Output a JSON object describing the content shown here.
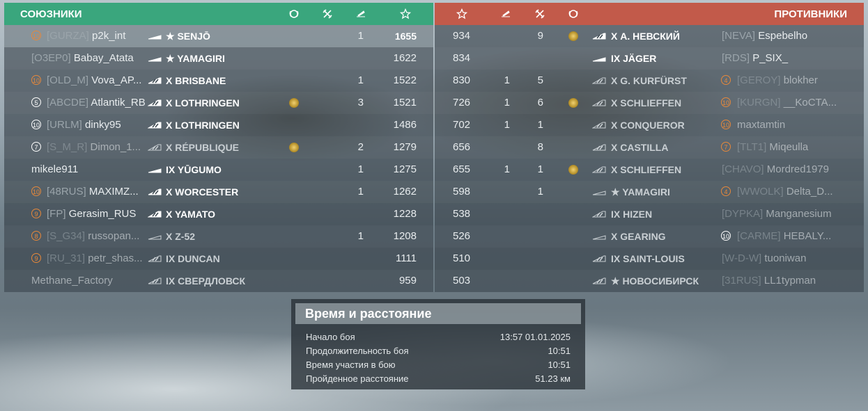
{
  "allies": {
    "title": "СОЮЗНИКИ",
    "header_icons": [
      "laurel-icon",
      "planes-icon",
      "ship-sunk-icon",
      "star-icon"
    ],
    "rows": [
      {
        "badge": "10",
        "badge_style": "orange",
        "clan": "[GURZA]",
        "player": "p2k_int",
        "ship_icon": "destroyer-filled",
        "ship": "★ SENJŌ",
        "medal": false,
        "kills": "1",
        "xp": "1655",
        "highlight": true,
        "dim": false
      },
      {
        "badge": "",
        "badge_style": "",
        "clan": "[O3EP0]",
        "player": "Babay_Atata",
        "ship_icon": "destroyer-white",
        "ship": "★ YAMAGIRI",
        "medal": false,
        "kills": "",
        "xp": "1622",
        "highlight": false,
        "dim": false
      },
      {
        "badge": "10",
        "badge_style": "orange",
        "clan": "[OLD_M]",
        "player": "Vova_AP...",
        "ship_icon": "cruiser-filled",
        "ship": "X BRISBANE",
        "medal": false,
        "kills": "1",
        "xp": "1522",
        "highlight": false,
        "dim": false
      },
      {
        "badge": "5",
        "badge_style": "white",
        "clan": "[ABCDE]",
        "player": "Atlantik_RB",
        "ship_icon": "battleship-filled",
        "ship": "X LOTHRINGEN",
        "medal": true,
        "kills": "3",
        "xp": "1521",
        "highlight": false,
        "dim": false
      },
      {
        "badge": "10",
        "badge_style": "white",
        "clan": "[URLM]",
        "player": "dinky95",
        "ship_icon": "battleship-filled",
        "ship": "X LOTHRINGEN",
        "medal": false,
        "kills": "",
        "xp": "1486",
        "highlight": false,
        "dim": false
      },
      {
        "badge": "7",
        "badge_style": "white",
        "clan": "[S_M_R]",
        "player": "Dimon_1...",
        "ship_icon": "battleship-outline",
        "ship": "X RÉPUBLIQUE",
        "medal": true,
        "kills": "2",
        "xp": "1279",
        "highlight": false,
        "dim": true
      },
      {
        "badge": "",
        "badge_style": "",
        "clan": "",
        "player": "mikele911",
        "ship_icon": "destroyer-white",
        "ship": "IX YŪGUMO",
        "medal": false,
        "kills": "1",
        "xp": "1275",
        "highlight": false,
        "dim": false
      },
      {
        "badge": "10",
        "badge_style": "orange",
        "clan": "[48RUS]",
        "player": "MAXIMZ...",
        "ship_icon": "cruiser-filled",
        "ship": "X WORCESTER",
        "medal": false,
        "kills": "1",
        "xp": "1262",
        "highlight": false,
        "dim": false
      },
      {
        "badge": "9",
        "badge_style": "orange",
        "clan": "[FP]",
        "player": "Gerasim_RUS",
        "ship_icon": "battleship-filled",
        "ship": "X YAMATO",
        "medal": false,
        "kills": "",
        "xp": "1228",
        "highlight": false,
        "dim": false
      },
      {
        "badge": "8",
        "badge_style": "orange",
        "clan": "[S_G34]",
        "player": "russopan...",
        "ship_icon": "destroyer-outline",
        "ship": "X Z-52",
        "medal": false,
        "kills": "1",
        "xp": "1208",
        "highlight": false,
        "dim": true
      },
      {
        "badge": "9",
        "badge_style": "orange",
        "clan": "[RU_31]",
        "player": "petr_shas...",
        "ship_icon": "cruiser-outline",
        "ship": "IX DUNCAN",
        "medal": false,
        "kills": "",
        "xp": "1111",
        "highlight": false,
        "dim": true
      },
      {
        "badge": "",
        "badge_style": "",
        "clan": "",
        "player": "Methane_Factory",
        "ship_icon": "cruiser-outline",
        "ship": "IX СВЕРДЛОВСК",
        "medal": false,
        "kills": "",
        "xp": "959",
        "highlight": false,
        "dim": true
      }
    ]
  },
  "enemies": {
    "title": "ПРОТИВНИКИ",
    "header_icons": [
      "star-icon",
      "ship-sunk-icon",
      "planes-icon",
      "laurel-icon"
    ],
    "rows": [
      {
        "xp": "934",
        "kills": "",
        "planes": "9",
        "medal": true,
        "ship_icon": "cruiser-filled",
        "ship": "X А. НЕВСКИЙ",
        "clan": "[NEVA]",
        "player": "Espebelho",
        "badge": "",
        "badge_style": "",
        "dim": false
      },
      {
        "xp": "834",
        "kills": "",
        "planes": "",
        "medal": false,
        "ship_icon": "destroyer-white",
        "ship": "IX JÄGER",
        "clan": "[RDS]",
        "player": "P_SIX_",
        "badge": "",
        "badge_style": "",
        "dim": false
      },
      {
        "xp": "830",
        "kills": "1",
        "planes": "5",
        "medal": false,
        "ship_icon": "battleship-outline",
        "ship": "X G. KURFÜRST",
        "clan": "[GEROY]",
        "player": "blokher",
        "badge": "4",
        "badge_style": "orange",
        "dim": true
      },
      {
        "xp": "726",
        "kills": "1",
        "planes": "6",
        "medal": true,
        "ship_icon": "battleship-outline",
        "ship": "X SCHLIEFFEN",
        "clan": "[KURGN]",
        "player": "__KoCTA...",
        "badge": "10",
        "badge_style": "orange",
        "dim": true
      },
      {
        "xp": "702",
        "kills": "1",
        "planes": "1",
        "medal": false,
        "ship_icon": "battleship-outline",
        "ship": "X CONQUEROR",
        "clan": "",
        "player": "maxtamtin",
        "badge": "10",
        "badge_style": "orange",
        "dim": true
      },
      {
        "xp": "656",
        "kills": "",
        "planes": "8",
        "medal": false,
        "ship_icon": "cruiser-outline",
        "ship": "X CASTILLA",
        "clan": "[TLT1]",
        "player": "Miqeulla",
        "badge": "7",
        "badge_style": "orange",
        "dim": true
      },
      {
        "xp": "655",
        "kills": "1",
        "planes": "1",
        "medal": true,
        "ship_icon": "battleship-outline",
        "ship": "X SCHLIEFFEN",
        "clan": "[CHAVO]",
        "player": "Mordred1979",
        "badge": "",
        "badge_style": "",
        "dim": true
      },
      {
        "xp": "598",
        "kills": "",
        "planes": "1",
        "medal": false,
        "ship_icon": "destroyer-outline",
        "ship": "★ YAMAGIRI",
        "clan": "[WWOLK]",
        "player": "Delta_D...",
        "badge": "4",
        "badge_style": "orange",
        "dim": true
      },
      {
        "xp": "538",
        "kills": "",
        "planes": "",
        "medal": false,
        "ship_icon": "battleship-outline",
        "ship": "IX HIZEN",
        "clan": "[DYPKA]",
        "player": "Manganesium",
        "badge": "",
        "badge_style": "",
        "dim": true
      },
      {
        "xp": "526",
        "kills": "",
        "planes": "",
        "medal": false,
        "ship_icon": "destroyer-outline",
        "ship": "X GEARING",
        "clan": "[CARME]",
        "player": "HEBALY...",
        "badge": "10",
        "badge_style": "white",
        "dim": true
      },
      {
        "xp": "510",
        "kills": "",
        "planes": "",
        "medal": false,
        "ship_icon": "cruiser-outline",
        "ship": "IX SAINT-LOUIS",
        "clan": "[W-D-W]",
        "player": "tuoniwan",
        "badge": "",
        "badge_style": "",
        "dim": true
      },
      {
        "xp": "503",
        "kills": "",
        "planes": "",
        "medal": false,
        "ship_icon": "cruiser-outline",
        "ship": "★ НОВОСИБИРСК",
        "clan": "[31RUS]",
        "player": "LL1typman",
        "badge": "",
        "badge_style": "",
        "dim": true
      }
    ]
  },
  "info": {
    "title": "Время и расстояние",
    "rows": [
      {
        "label": "Начало боя",
        "value": "13:57  01.01.2025"
      },
      {
        "label": "Продолжительность боя",
        "value": "10:51"
      },
      {
        "label": "Время участия в бою",
        "value": "10:51"
      },
      {
        "label": "Пройденное расстояние",
        "value": "51.23 км"
      }
    ]
  },
  "colors": {
    "allies_header": "#3aa67d",
    "enemies_header": "#c25a4a",
    "badge_orange": "#e7883a",
    "medal_gold": "#d4b04a"
  }
}
